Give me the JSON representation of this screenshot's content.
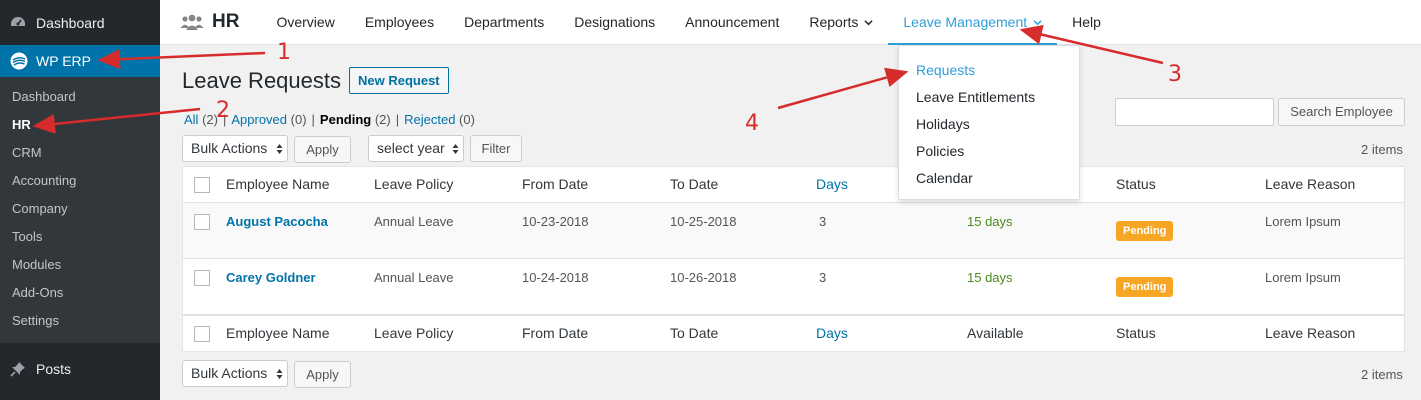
{
  "sidebar": {
    "dashboard_label": "Dashboard",
    "active_label": "WP ERP",
    "submenu": [
      "Dashboard",
      "HR",
      "CRM",
      "Accounting",
      "Company",
      "Tools",
      "Modules",
      "Add-Ons",
      "Settings"
    ],
    "posts_label": "Posts",
    "bg_color": "#23282d",
    "active_color": "#0073aa"
  },
  "topbar": {
    "brand": "HR",
    "nav": [
      "Overview",
      "Employees",
      "Departments",
      "Designations",
      "Announcement",
      "Reports",
      "Leave Management",
      "Help"
    ],
    "active_nav": "Leave Management",
    "accent_color": "#2e9fd8"
  },
  "dropdown": {
    "items": [
      "Requests",
      "Leave Entitlements",
      "Holidays",
      "Policies",
      "Calendar"
    ]
  },
  "page": {
    "title": "Leave Requests",
    "new_button": "New Request",
    "filters": [
      {
        "label": "All",
        "count": "(2)"
      },
      {
        "label": "Approved",
        "count": "(0)"
      },
      {
        "label": "Pending",
        "count": "(2)"
      },
      {
        "label": "Rejected",
        "count": "(0)"
      }
    ],
    "separator": "|",
    "search_button": "Search Employee",
    "search_value": "",
    "bulk_actions": "Bulk Actions",
    "apply": "Apply",
    "select_year": "select year",
    "filter": "Filter",
    "items_count": "2 items"
  },
  "table": {
    "columns": [
      "Employee Name",
      "Leave Policy",
      "From Date",
      "To Date",
      "Days",
      "Available",
      "Status",
      "Leave Reason"
    ],
    "rows": [
      {
        "name": "August Pacocha",
        "policy": "Annual Leave",
        "from": "10-23-2018",
        "to": "10-25-2018",
        "days": "3",
        "available": "15 days",
        "status": "Pending",
        "reason": "Lorem Ipsum"
      },
      {
        "name": "Carey Goldner",
        "policy": "Annual Leave",
        "from": "10-24-2018",
        "to": "10-26-2018",
        "days": "3",
        "available": "15 days",
        "status": "Pending",
        "reason": "Lorem Ipsum"
      }
    ]
  },
  "annotations": [
    "1",
    "2",
    "3",
    "4"
  ],
  "annotation_color": "#d62c2c"
}
